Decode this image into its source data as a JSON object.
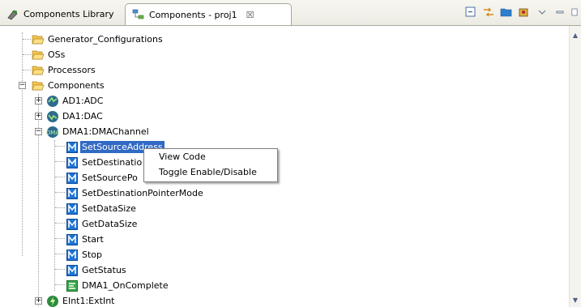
{
  "tabs": [
    {
      "label": "Components Library",
      "icon": "components-library-icon",
      "active": false
    },
    {
      "label": "Components - proj1",
      "icon": "components-tree-icon",
      "active": true,
      "close": "☒"
    }
  ],
  "toolbar": {
    "buttons": [
      "collapse-all-icon",
      "link-with-editor-icon",
      "open-folder-icon",
      "component-inspector-icon",
      "view-menu-icon",
      "minimize-icon",
      "maximize-icon"
    ]
  },
  "tree": {
    "items": [
      {
        "label": "Generator_Configurations",
        "icon": "folder-icon"
      },
      {
        "label": "OSs",
        "icon": "folder-icon"
      },
      {
        "label": "Processors",
        "icon": "folder-icon"
      },
      {
        "label": "Components",
        "icon": "folder-icon"
      },
      {
        "label": "AD1:ADC",
        "icon": "component-icon"
      },
      {
        "label": "DA1:DAC",
        "icon": "component-icon"
      },
      {
        "label": "DMA1:DMAChannel",
        "icon": "component-icon"
      },
      {
        "label": "SetSourceAddress",
        "icon": "method-icon"
      },
      {
        "label": "SetDestinatio",
        "icon": "method-icon"
      },
      {
        "label": "SetSourcePo",
        "icon": "method-icon"
      },
      {
        "label": "SetDestinationPointerMode",
        "icon": "method-icon"
      },
      {
        "label": "SetDataSize",
        "icon": "method-icon"
      },
      {
        "label": "GetDataSize",
        "icon": "method-icon"
      },
      {
        "label": "Start",
        "icon": "method-icon"
      },
      {
        "label": "Stop",
        "icon": "method-icon"
      },
      {
        "label": "GetStatus",
        "icon": "method-icon"
      },
      {
        "label": "DMA1_OnComplete",
        "icon": "event-icon"
      },
      {
        "label": "EInt1:ExtInt",
        "icon": "component-icon"
      }
    ]
  },
  "context_menu": {
    "items": [
      "View Code",
      "Toggle Enable/Disable"
    ]
  },
  "colors": {
    "selection": "#316ac5",
    "folder": "#f4c64a",
    "method": "#1e74d4"
  }
}
